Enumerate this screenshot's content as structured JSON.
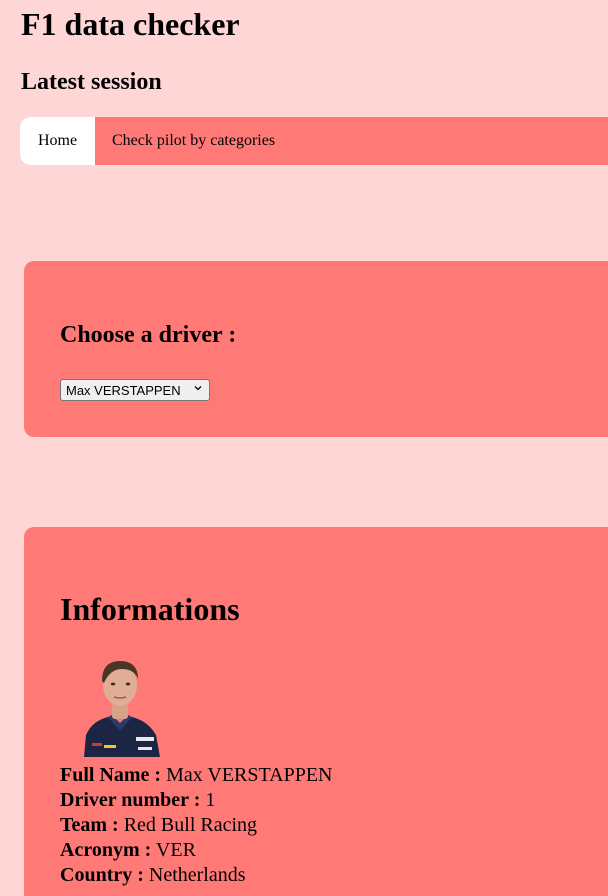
{
  "header": {
    "title": "F1 data checker",
    "subtitle": "Latest session"
  },
  "nav": {
    "items": [
      {
        "label": "Home",
        "active": true
      },
      {
        "label": "Check pilot by categories",
        "active": false
      }
    ]
  },
  "choose": {
    "heading": "Choose a driver :",
    "selected": "Max VERSTAPPEN"
  },
  "info": {
    "heading": "Informations",
    "photo_icon": "driver-portrait-icon",
    "fields": [
      {
        "label": "Full Name :",
        "value": "Max VERSTAPPEN"
      },
      {
        "label": "Driver number :",
        "value": "1"
      },
      {
        "label": "Team :",
        "value": "Red Bull Racing"
      },
      {
        "label": "Acronym :",
        "value": "VER"
      },
      {
        "label": "Country :",
        "value": "Netherlands"
      }
    ]
  },
  "colors": {
    "background": "#ffd6d6",
    "accent": "#ff7a77",
    "active_tab": "#ffffff"
  }
}
